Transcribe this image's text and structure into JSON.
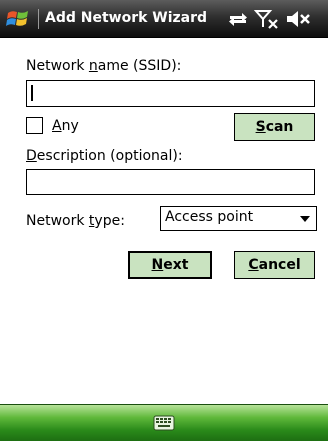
{
  "titlebar": {
    "title": "Add Network Wizard",
    "icons": [
      "windows-start-icon",
      "connectivity-icon",
      "signal-off-icon",
      "volume-muted-icon"
    ]
  },
  "form": {
    "network_name_label_pre": "Network ",
    "network_name_label_key": "n",
    "network_name_label_post": "ame (SSID):",
    "network_name_value": "",
    "any_label_key": "A",
    "any_label_post": "ny",
    "any_checked": false,
    "scan_key": "S",
    "scan_post": "can",
    "description_label_key": "D",
    "description_label_post": "escription (optional):",
    "description_value": "",
    "network_type_label_pre": "Network ",
    "network_type_label_key": "t",
    "network_type_label_post": "ype:",
    "network_type_value": "Access point"
  },
  "buttons": {
    "next_key": "N",
    "next_post": "ext",
    "cancel_key": "C",
    "cancel_post": "ancel"
  },
  "menubar": {
    "icon": "keyboard-icon"
  },
  "colors": {
    "button_bg": "#c9e3c0",
    "menubar_green": "#2a8a1a",
    "titlebar_dark": "#1a1a1a"
  }
}
